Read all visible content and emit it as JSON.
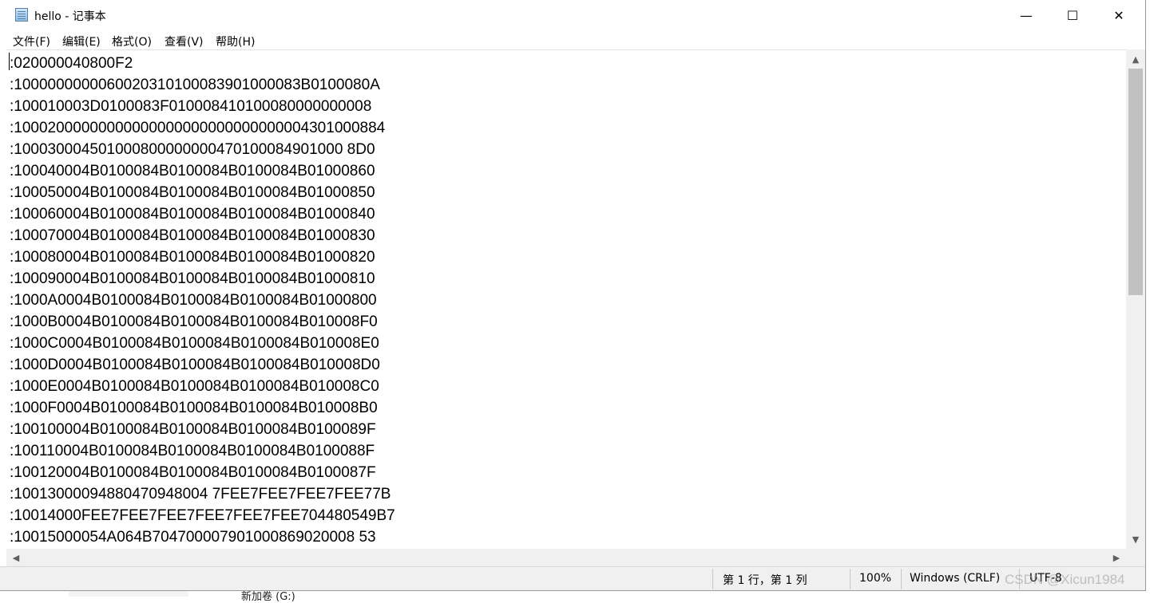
{
  "window": {
    "title": "hello - 记事本",
    "controls": {
      "minimize": "—",
      "maximize": "☐",
      "close": "✕"
    }
  },
  "menu": [
    "文件(F)",
    "编辑(E)",
    "格式(O)",
    "查看(V)",
    "帮助(H)"
  ],
  "lines": [
    ":020000040800F2",
    ":1000000000060020310100083901000083B0100080A",
    ":100010003D0100083F010008410100080000000008",
    ":10002000000000000000000000000000004301000884",
    ":100030004501000800000000470100084901000 8D0",
    ":100040004B0100084B0100084B0100084B01000860",
    ":100050004B0100084B0100084B0100084B01000850",
    ":100060004B0100084B0100084B0100084B01000840",
    ":100070004B0100084B0100084B0100084B01000830",
    ":100080004B0100084B0100084B0100084B01000820",
    ":100090004B0100084B0100084B0100084B01000810",
    ":1000A0004B0100084B0100084B0100084B01000800",
    ":1000B0004B0100084B0100084B0100084B010008F0",
    ":1000C0004B0100084B0100084B0100084B010008E0",
    ":1000D0004B0100084B0100084B0100084B010008D0",
    ":1000E0004B0100084B0100084B0100084B010008C0",
    ":1000F0004B0100084B0100084B0100084B010008B0",
    ":100100004B0100084B0100084B0100084B0100089F",
    ":100110004B0100084B0100084B0100084B0100088F",
    ":100120004B0100084B0100084B0100084B0100087F",
    ":10013000094880470948004 7FEE7FEE7FEE7FEE77B",
    ":10014000FEE7FEE7FEE7FEE7FEE7FEE704480549B7",
    ":10015000054A064B704700007901000869020008 53"
  ],
  "status": {
    "position": "第 1 行，第 1 列",
    "zoom": "100%",
    "line_ending": "Windows (CRLF)",
    "encoding": "UTF-8"
  },
  "watermark": "CSDN @Xicun1984",
  "background_window": {
    "drive_label": "新加卷 (G:)"
  }
}
